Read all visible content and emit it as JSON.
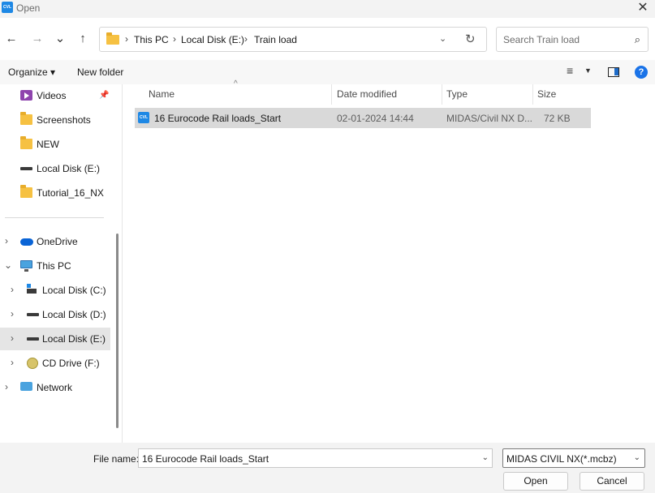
{
  "window": {
    "title": "Open",
    "app_icon_text": "CVL",
    "close_glyph": "✕"
  },
  "nav": {
    "back_glyph": "←",
    "forward_glyph": "→",
    "recent_glyph": "⌄",
    "up_glyph": "↑",
    "breadcrumbs": [
      "This PC",
      "Local Disk (E:)",
      "Train load"
    ],
    "separator": "›",
    "dropdown_glyph": "⌄",
    "refresh_glyph": "↻",
    "search_placeholder": "Search Train load",
    "search_glyph": "⌕"
  },
  "toolbar": {
    "organize_label": "Organize ▾",
    "new_folder_label": "New folder",
    "view_glyph": "≡",
    "view_drop_glyph": "▼",
    "help_glyph": "?"
  },
  "sidebar": {
    "pin_glyph": "📌",
    "quick_access": [
      {
        "label": "Videos"
      },
      {
        "label": "Screenshots"
      },
      {
        "label": "NEW"
      },
      {
        "label": "Local Disk (E:)"
      },
      {
        "label": "Tutorial_16_NX"
      }
    ],
    "tree": [
      {
        "label": "OneDrive",
        "chevron": "›"
      },
      {
        "label": "This PC",
        "chevron": "⌄"
      },
      {
        "label": "Local Disk (C:)",
        "chevron": "›"
      },
      {
        "label": "Local Disk (D:)",
        "chevron": "›"
      },
      {
        "label": "Local Disk (E:)",
        "chevron": "›"
      },
      {
        "label": "CD Drive (F:)",
        "chevron": "›"
      },
      {
        "label": "Network",
        "chevron": "›"
      }
    ]
  },
  "file_list": {
    "sort_glyph": "^",
    "columns": [
      "Name",
      "Date modified",
      "Type",
      "Size"
    ],
    "rows": [
      {
        "icon_text": "CVL",
        "name": "16 Eurocode Rail loads_Start",
        "date": "02-01-2024 14:44",
        "type": "MIDAS/Civil NX D...",
        "size": "72 KB"
      }
    ]
  },
  "footer": {
    "file_name_label": "File name:",
    "file_name_value": "16 Eurocode Rail loads_Start",
    "drop_glyph": "⌄",
    "filter_value": "MIDAS CIVIL NX(*.mcbz)",
    "open_label": "Open",
    "cancel_label": "Cancel"
  }
}
